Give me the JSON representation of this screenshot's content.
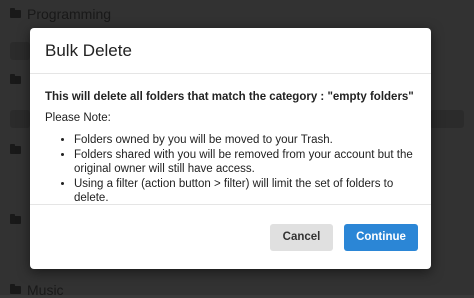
{
  "background": {
    "headings": [
      "Programming",
      "",
      "",
      "",
      "Music"
    ]
  },
  "dialog": {
    "title": "Bulk Delete",
    "warning": "This will delete all folders that match the category : \"empty folders\"",
    "note_label": "Please Note:",
    "notes": [
      "Folders owned by you will be moved to your Trash.",
      "Folders shared with you will be removed from your account but the original owner will still have access.",
      "Using a filter (action button > filter) will limit the set of folders to delete."
    ],
    "cancel_label": "Cancel",
    "continue_label": "Continue"
  },
  "colors": {
    "primary": "#2b86d6",
    "overlay": "#3a3a3a"
  }
}
